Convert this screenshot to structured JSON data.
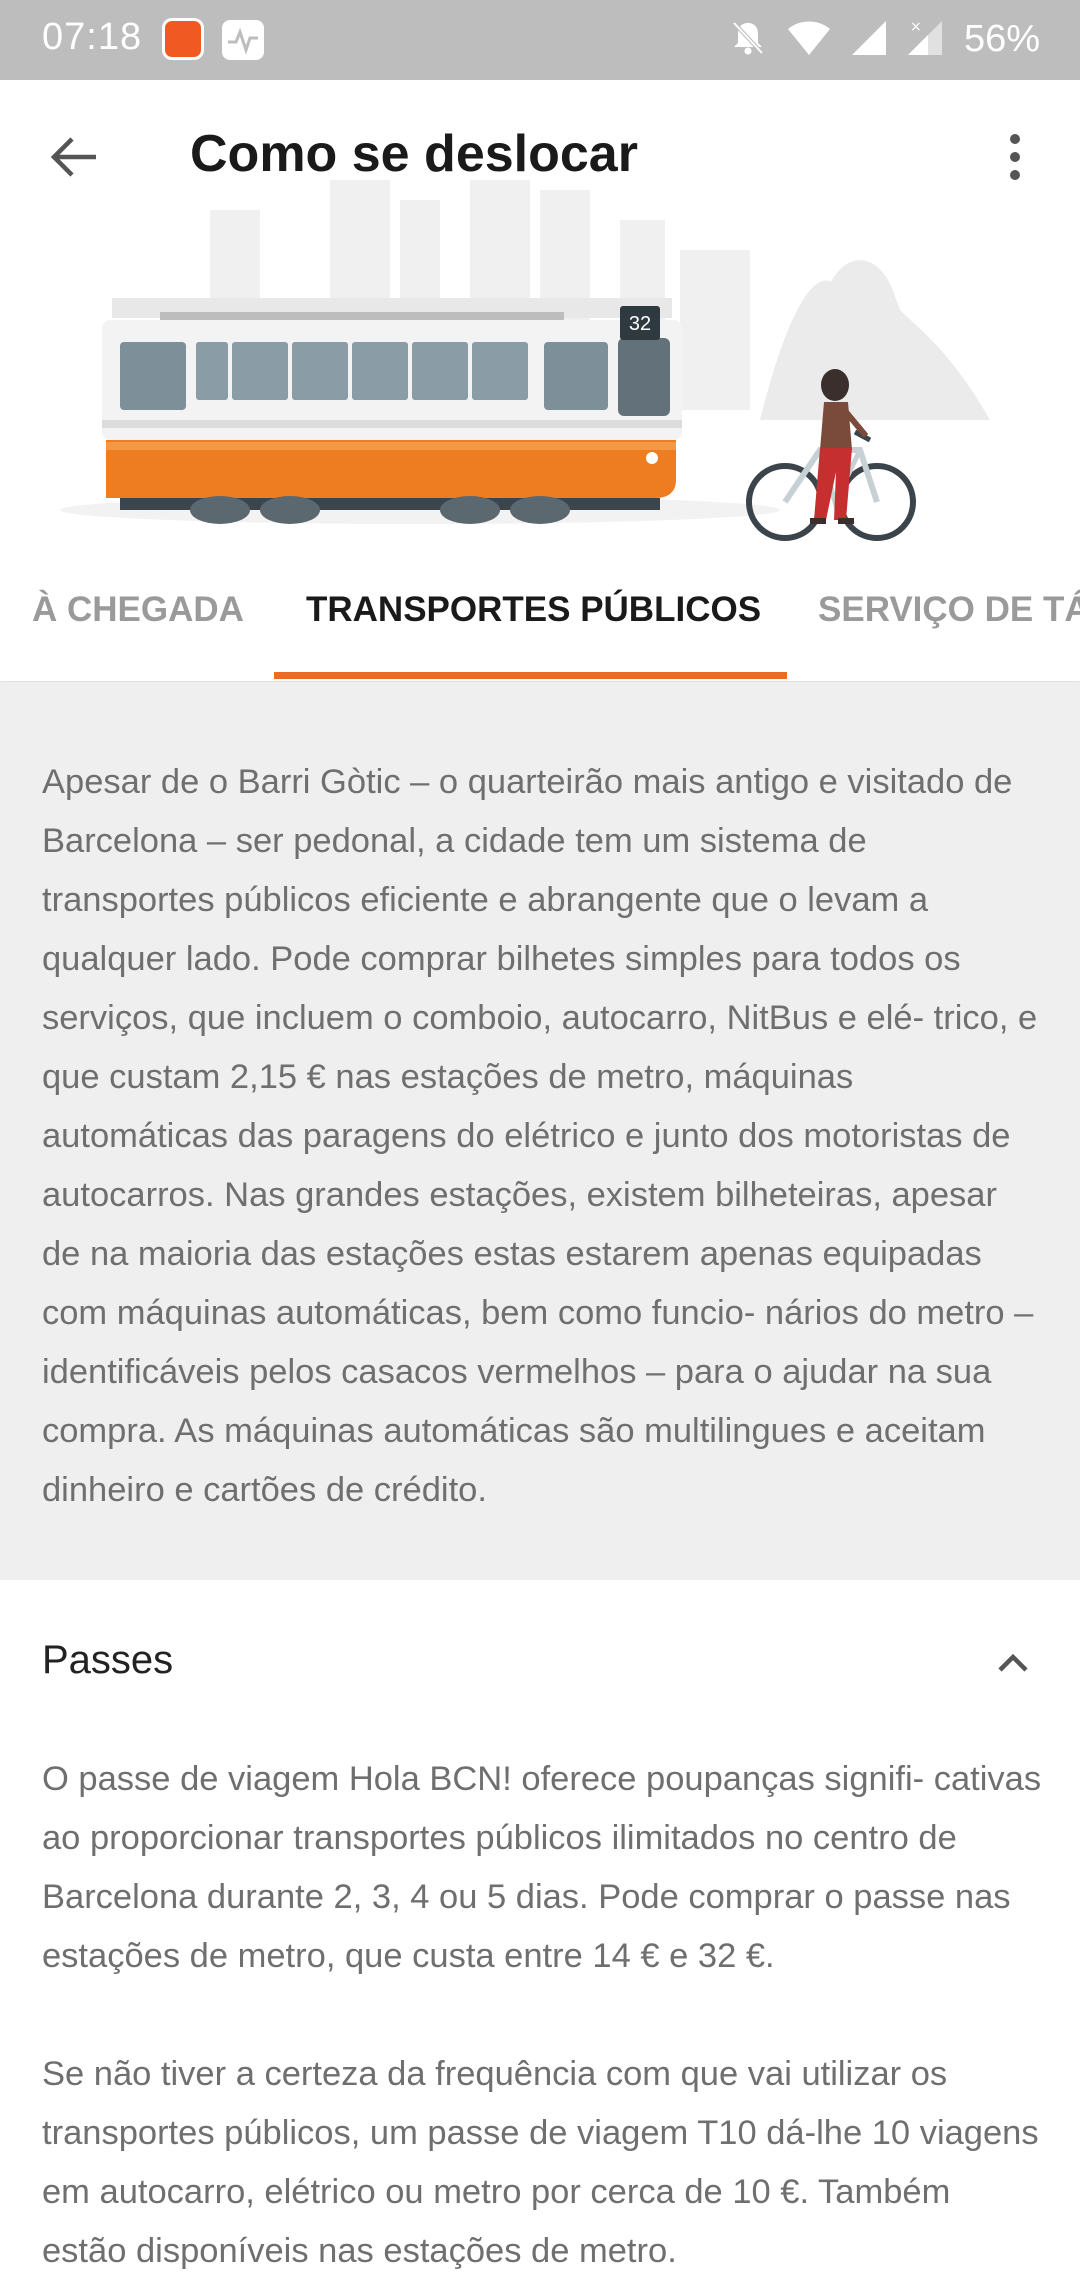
{
  "status_bar": {
    "time": "07:18",
    "battery": "56%",
    "icons": [
      "mi-app-icon",
      "pulse-app-icon",
      "mute-icon",
      "wifi-icon",
      "signal-icon",
      "signal-no-data-icon"
    ]
  },
  "app_bar": {
    "title": "Como se deslocar",
    "back_icon": "arrow-back-icon",
    "more_icon": "more-vert-icon"
  },
  "hero": {
    "tram_number": "32"
  },
  "tabs": [
    {
      "label": "À CHEGADA",
      "active": false
    },
    {
      "label": "TRANSPORTES PÚBLICOS",
      "active": true
    },
    {
      "label": "SERVIÇO DE TÁ",
      "active": false
    }
  ],
  "intro": {
    "text": "Apesar de o Barri Gòtic – o quarteirão mais antigo e visitado de Barcelona – ser pedonal, a cidade tem um sistema de transportes públicos eficiente e abrangente que o levam a qualquer lado. Pode comprar bilhetes simples para todos os serviços, que incluem o comboio, autocarro, NitBus e elé- trico, e que custam 2,15 € nas estações de metro, máquinas automáticas das paragens do elétrico e junto dos motoristas de autocarros. Nas grandes estações, existem bilheteiras, apesar de na maioria das estações estas estarem apenas equipadas com máquinas automáticas, bem como funcio- nários do metro – identificáveis pelos casacos vermelhos – para o ajudar na sua compra. As máquinas automáticas são multilingues e aceitam dinheiro e cartões de crédito."
  },
  "passes": {
    "heading": "Passes",
    "paragraphs": [
      "O passe de viagem Hola BCN! oferece poupanças signifi- cativas ao proporcionar transportes públicos ilimitados no centro de Barcelona durante 2, 3, 4 ou 5 dias. Pode comprar o passe nas estações de metro, que custa entre 14 € e 32 €.",
      "Se não tiver a certeza da frequência com que vai utilizar os transportes públicos, um passe de viagem T10 dá-lhe 10 viagens em autocarro, elétrico ou metro por cerca de 10 €. Também estão disponíveis nas estações de metro."
    ]
  },
  "colors": {
    "accent": "#ec6a22",
    "status_bar": "#bdbdbd",
    "intro_bg": "#efefef"
  }
}
